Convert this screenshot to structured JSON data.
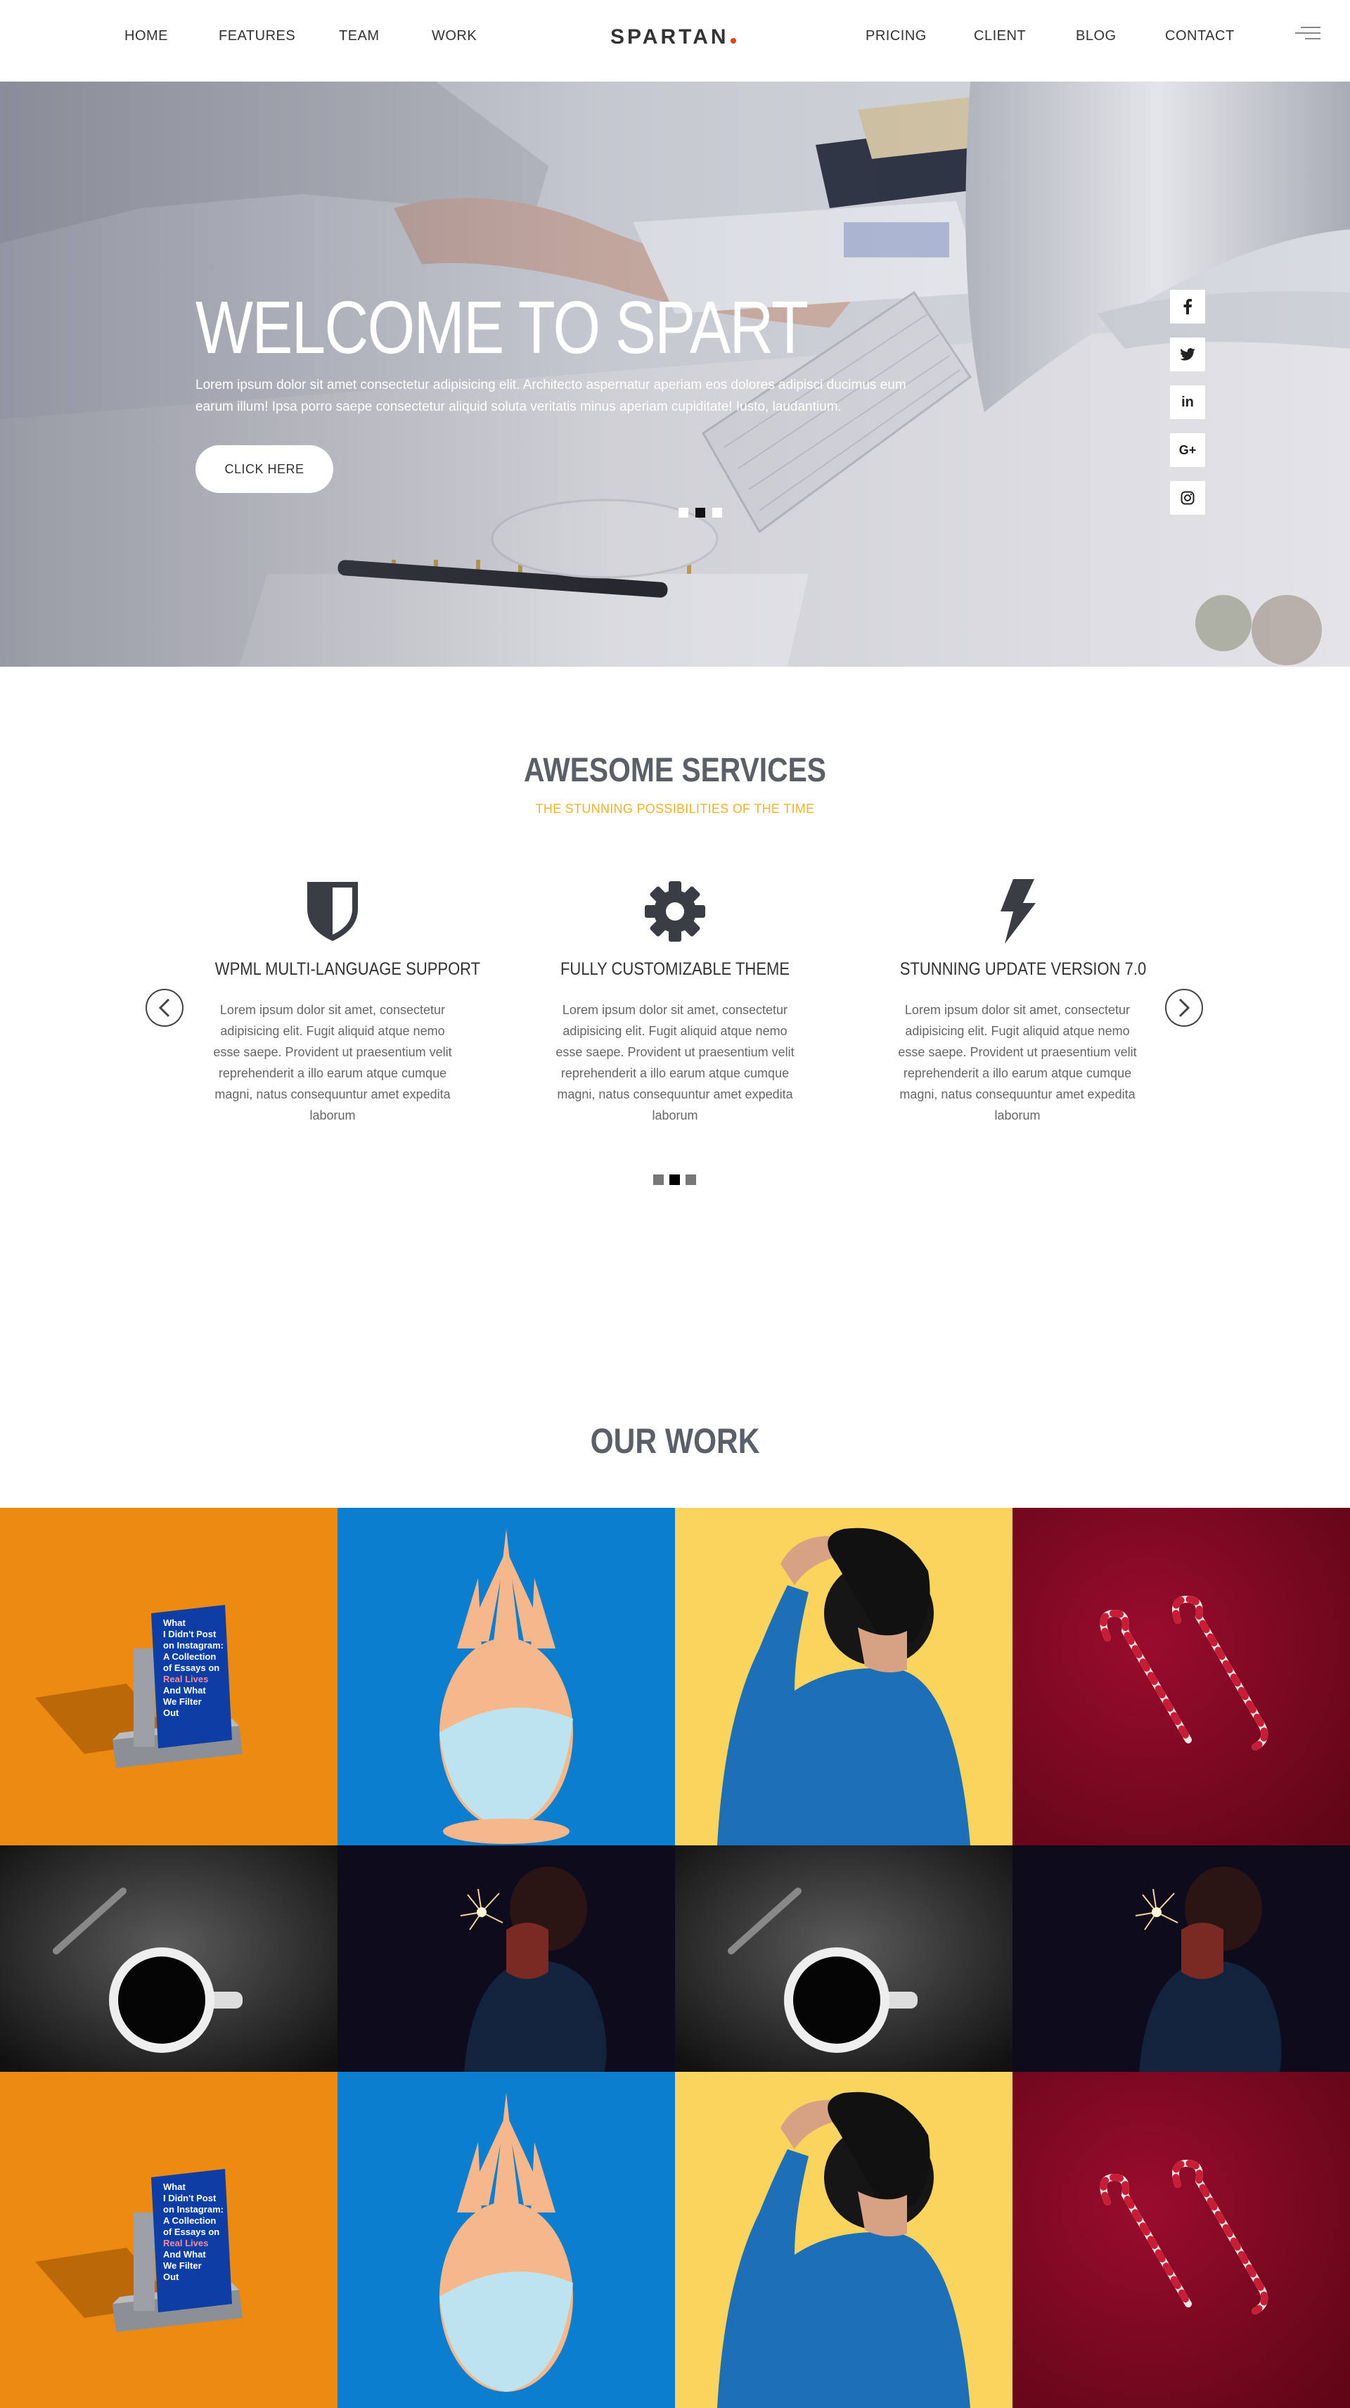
{
  "nav": {
    "left_links": [
      "HOME",
      "FEATURES",
      "TEAM",
      "WORK"
    ],
    "brand": "SPARTAN",
    "right_links": [
      "PRICING",
      "CLIENT",
      "BLOG",
      "CONTACT"
    ],
    "menu_icon": "hamburger-icon"
  },
  "hero": {
    "title": "WELCOME TO SPART",
    "text": "Lorem ipsum dolor sit amet consectetur adipisicing elit. Architecto aspernatur aperiam eos dolores adipisci ducimus eum earum illum! Ipsa porro saepe consectetur aliquid soluta veritatis minus aperiam cupiditate! Iusto, laudantium.",
    "button": "CLICK HERE",
    "slides": 3,
    "active_slide": 2,
    "social": [
      {
        "icon": "facebook-icon",
        "glyph": "f"
      },
      {
        "icon": "twitter-icon",
        "glyph": "t"
      },
      {
        "icon": "linkedin-icon",
        "glyph": "in"
      },
      {
        "icon": "google-plus-icon",
        "glyph": "G+"
      },
      {
        "icon": "instagram-icon",
        "glyph": "◎"
      }
    ]
  },
  "services": {
    "title": "AWESOME SERVICES",
    "subtitle": "THE STUNNING POSSIBILITIES OF THE TIME",
    "items": [
      {
        "icon": "shield-icon",
        "title": "WPML MULTI-LANGUAGE SUPPORT",
        "text": "Lorem ipsum dolor sit amet, consectetur adipisicing elit. Fugit aliquid atque nemo esse saepe. Provident ut praesentium velit reprehenderit a illo earum atque cumque magni, natus consequuntur amet expedita laborum"
      },
      {
        "icon": "gear-icon",
        "title": "FULLY CUSTOMIZABLE THEME",
        "text": "Lorem ipsum dolor sit amet, consectetur adipisicing elit. Fugit aliquid atque nemo esse saepe. Provident ut praesentium velit reprehenderit a illo earum atque cumque magni, natus consequuntur amet expedita laborum"
      },
      {
        "icon": "lightning-icon",
        "title": "STUNNING UPDATE VERSION 7.0",
        "text": "Lorem ipsum dolor sit amet, consectetur adipisicing elit. Fugit aliquid atque nemo esse saepe. Provident ut praesentium velit reprehenderit a illo earum atque cumque magni, natus consequuntur amet expedita laborum"
      }
    ],
    "prev_icon": "chevron-left-icon",
    "next_icon": "chevron-right-icon",
    "pages": 3,
    "active_page": 2
  },
  "work": {
    "title": "OUR WORK",
    "book_text": [
      "What",
      "I Didn't Post",
      "on Instagram:",
      "A Collection",
      "of Essays on",
      "Real Lives",
      "And What",
      "We Filter",
      "Out"
    ],
    "tiles": [
      {
        "kind": "book",
        "bg": "#ec8a12"
      },
      {
        "kind": "pineapple",
        "bg": "#0b7ed0"
      },
      {
        "kind": "person",
        "bg": "#fbd45e"
      },
      {
        "kind": "candy",
        "bg": "#7e0a22"
      },
      {
        "kind": "coffee",
        "bg": "#2a2a2a"
      },
      {
        "kind": "sparkler",
        "bg": "#0e0b1c"
      },
      {
        "kind": "coffee",
        "bg": "#2a2a2a"
      },
      {
        "kind": "sparkler",
        "bg": "#0e0b1c"
      },
      {
        "kind": "book",
        "bg": "#ec8a12"
      },
      {
        "kind": "pineapple",
        "bg": "#0b7ed0"
      },
      {
        "kind": "person",
        "bg": "#fbd45e"
      },
      {
        "kind": "candy",
        "bg": "#7e0a22"
      }
    ]
  },
  "colors": {
    "accent": "#f3b12a",
    "brand_dot": "#e8401c",
    "heading": "#5b6068"
  }
}
